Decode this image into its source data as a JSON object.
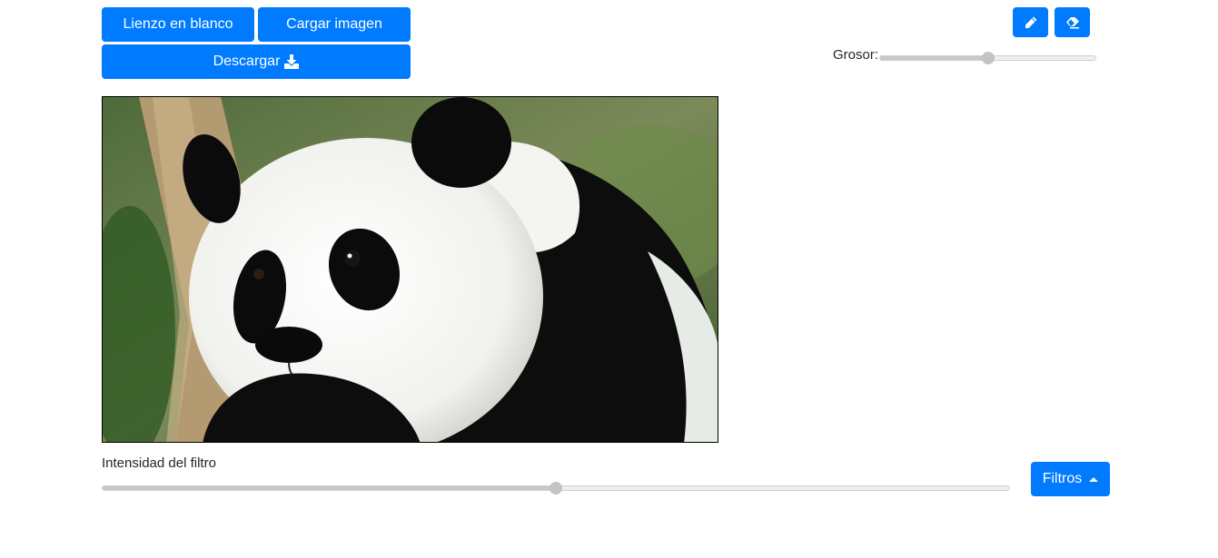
{
  "toolbar": {
    "blank_canvas_label": "Lienzo en blanco",
    "load_image_label": "Cargar imagen",
    "download_label": "Descargar",
    "download_icon": "download-icon",
    "pencil_icon": "pencil-icon",
    "eraser_icon": "eraser-icon"
  },
  "thickness": {
    "label": "Grosor:",
    "value_fraction": 0.5
  },
  "filter": {
    "intensity_label": "Intensidad del filtro",
    "intensity_fraction": 0.5,
    "menu_label": "Filtros",
    "menu_icon": "caret-up-icon"
  },
  "canvas": {
    "content": "panda-photo"
  },
  "colors": {
    "primary": "#007bff",
    "text": "#212529"
  }
}
